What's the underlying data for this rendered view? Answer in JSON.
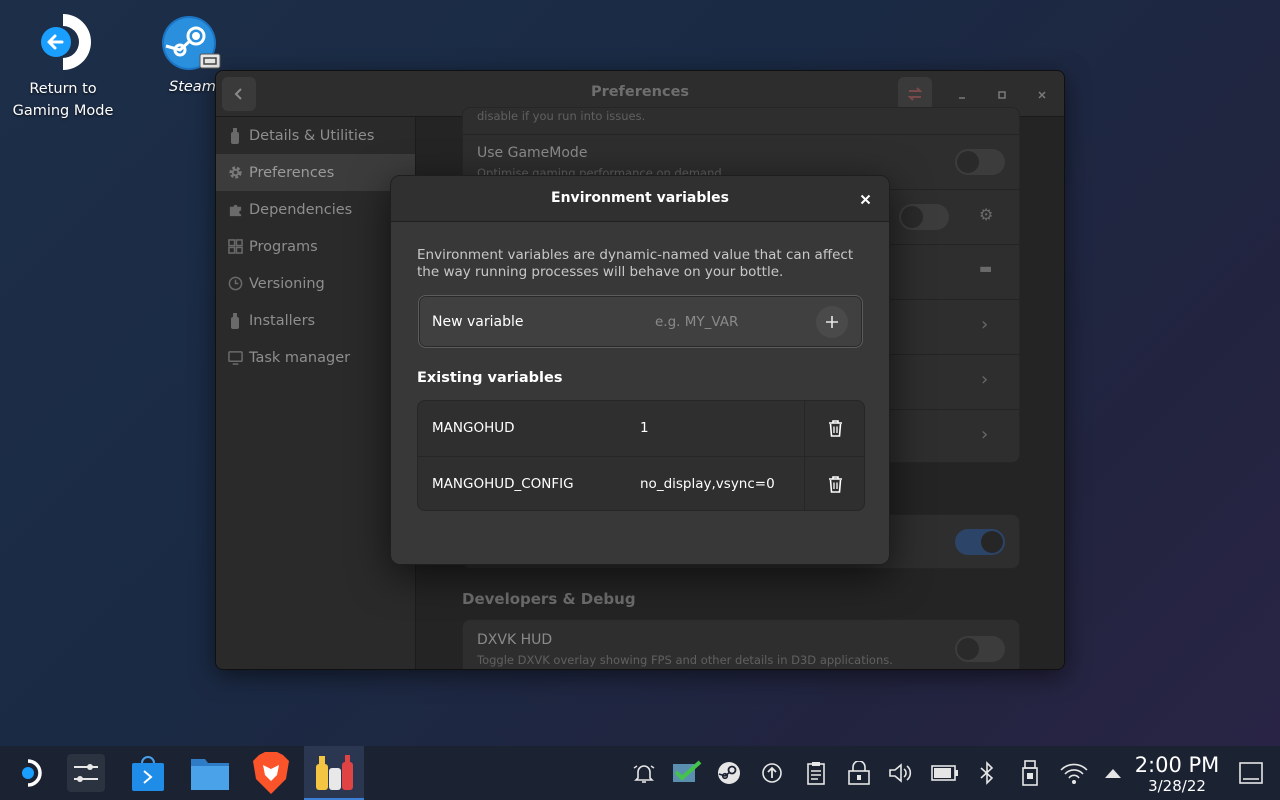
{
  "desktop": {
    "icons": [
      {
        "label": "Return to Gaming Mode"
      },
      {
        "label": "Steam"
      }
    ]
  },
  "window": {
    "title": "Preferences",
    "sidebar": [
      {
        "label": "Details & Utilities",
        "icon": "bottle-icon"
      },
      {
        "label": "Preferences",
        "icon": "gear-icon",
        "active": true
      },
      {
        "label": "Dependencies",
        "icon": "puzzle-icon"
      },
      {
        "label": "Programs",
        "icon": "grid-icon"
      },
      {
        "label": "Versioning",
        "icon": "clock-icon"
      },
      {
        "label": "Installers",
        "icon": "bottle-icon"
      },
      {
        "label": "Task manager",
        "icon": "monitor-icon"
      }
    ],
    "settings": {
      "partial_subtitle": "disable if you run into issues.",
      "gamemode_title": "Use GameMode",
      "gamemode_subtitle": "Optimise gaming performance on demand.",
      "dev_section": "Developers & Debug",
      "dxvk_title": "DXVK HUD",
      "dxvk_subtitle": "Toggle DXVK overlay showing FPS and other details in D3D applications."
    }
  },
  "modal": {
    "title": "Environment variables",
    "description": "Environment variables are dynamic-named value that can affect the way running processes will behave on your bottle.",
    "new_variable_label": "New variable",
    "new_variable_placeholder": "e.g. MY_VAR",
    "existing_title": "Existing variables",
    "variables": [
      {
        "name": "MANGOHUD",
        "value": "1"
      },
      {
        "name": "MANGOHUD_CONFIG",
        "value": "no_display,vsync=0"
      }
    ]
  },
  "taskbar": {
    "time": "2:00 PM",
    "date": "3/28/22"
  },
  "colors": {
    "accent": "#3b7fd6",
    "desktop_bg": "#1d2e48"
  }
}
